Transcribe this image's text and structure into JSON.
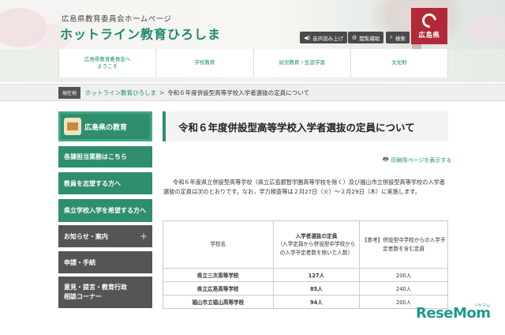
{
  "header": {
    "subtitle": "広島県教育委員会ホームページ",
    "title": "ホットライン教育ひろしま",
    "tools": [
      {
        "label": "音声読み上げ",
        "icon": "speaker-icon"
      },
      {
        "label": "閲覧補助",
        "icon": "gear-icon"
      },
      {
        "label": "検索",
        "icon": "search-icon"
      }
    ],
    "pref_logo": "広島県"
  },
  "nav": {
    "items": [
      {
        "label_line1": "広島県教育委員会へ",
        "label_line2": "ようこそ"
      },
      {
        "label_line1": "学校教育",
        "label_line2": ""
      },
      {
        "label_line1": "幼児教育・生涯学習",
        "label_line2": ""
      },
      {
        "label_line1": "文化財",
        "label_line2": ""
      }
    ]
  },
  "breadcrumb": {
    "tag": "現在地",
    "home": "ホットライン教育ひろしま",
    "sep": ">",
    "current": "令和６年度併設型高等学校入学者選抜の定員について"
  },
  "sidebar": {
    "banner": "広島県の教育",
    "items": [
      {
        "label": "各課担当業務はこちら"
      },
      {
        "label": "教員を志望する方へ"
      },
      {
        "label": "県立学校入学を希望する方へ"
      },
      {
        "label": "お知らせ・案内",
        "expand": "+"
      },
      {
        "label": "申請・手続"
      },
      {
        "label_line1": "意見・提言・教育行政",
        "label_line2": "相談コーナー"
      }
    ]
  },
  "main": {
    "title": "令和６年度併設型高等学校入学者選抜の定員について",
    "print_label": "印刷用ページを表示する",
    "body": "令和６年度県立併設型高等学校（県立広島叡智学園高等学校を除く）及び福山市立併設型高等学校の入学者選抜の定員は次のとおりです。なお，学力検査等は２月27日（火）～２月29日（木）に実施します。",
    "table": {
      "headers": {
        "school": "学校名",
        "quota_title": "入学者選抜の定員",
        "quota_sub": "（入学定員から併設型中学校からの入学予定者数を除いた人数）",
        "ref": "【参考】併設型中学校からの入学予定者数を含む定員"
      },
      "rows": [
        {
          "school": "県立三次高等学校",
          "quota": "127人",
          "ref": "200人"
        },
        {
          "school": "県立広島高等学校",
          "quota": "85人",
          "ref": "240人"
        },
        {
          "school": "福山市立福山高等学校",
          "quota": "94人",
          "ref": "200人"
        }
      ]
    }
  },
  "watermark": {
    "text": "ReseMom",
    "small": "リセマム"
  },
  "colors": {
    "accent": "#1d8a6b",
    "sidebar_green": "#2f8e6d",
    "sidebar_gray": "#555555",
    "pref_red": "#b22a37"
  }
}
